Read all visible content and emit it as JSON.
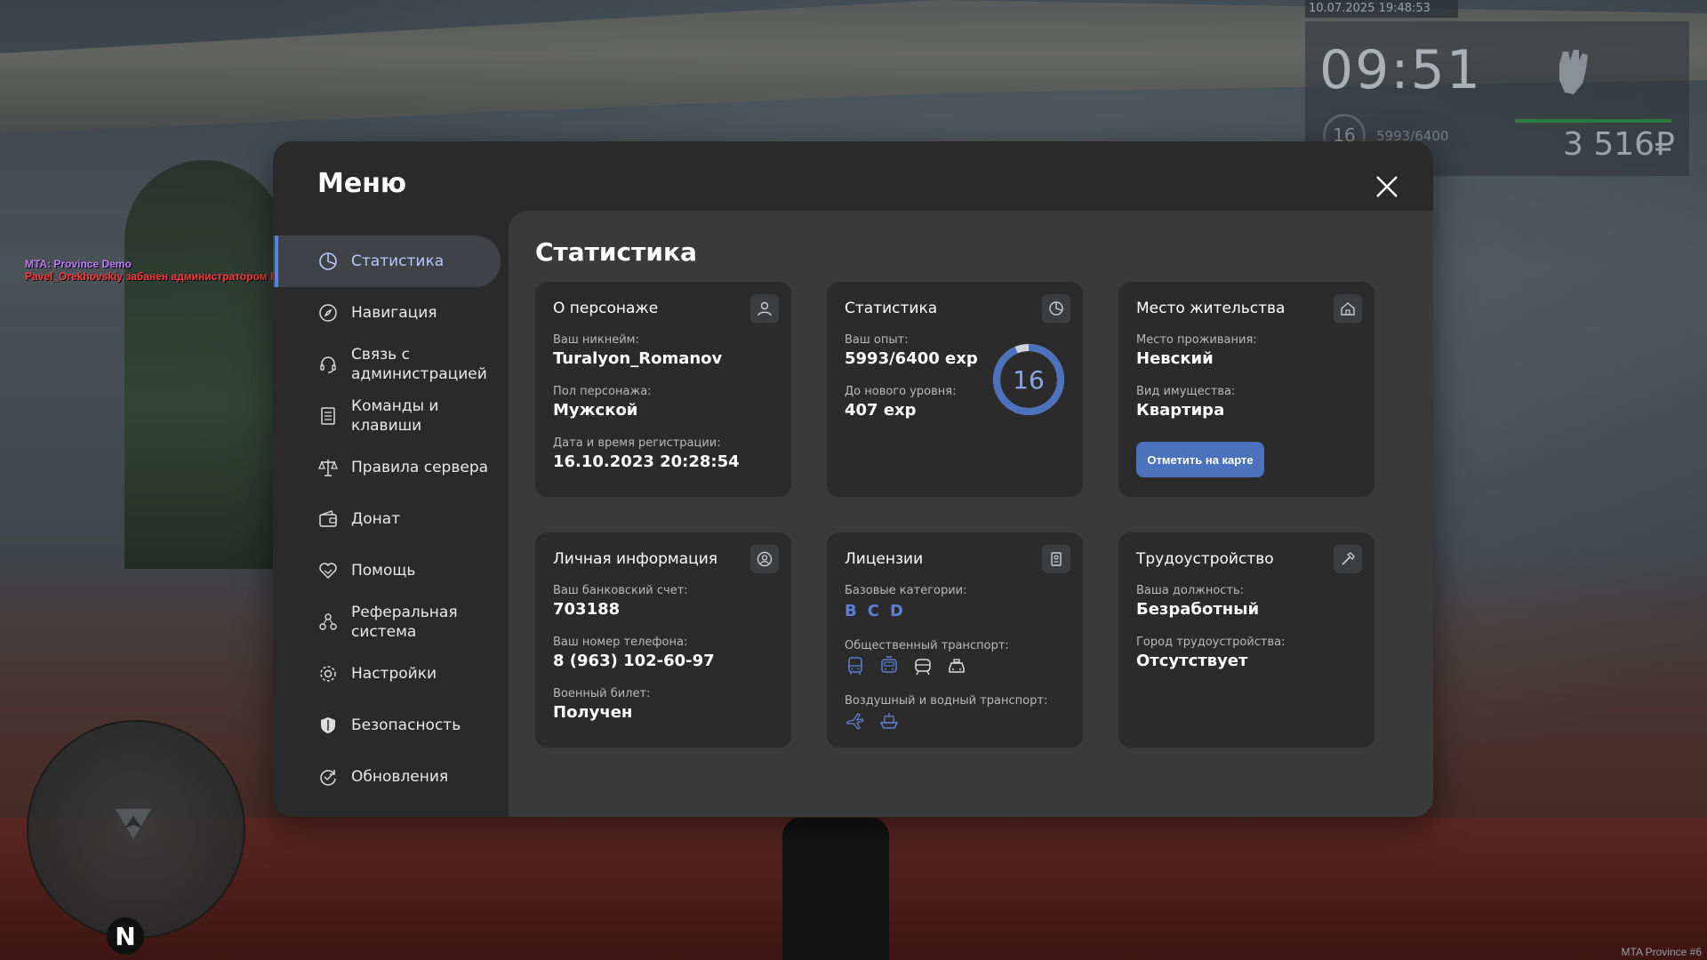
{
  "hud": {
    "datetime": "10.07.2025 19:48:53",
    "time": "09:51",
    "level": "16",
    "exp": "5993/6400",
    "money": "3 516₽"
  },
  "chat": {
    "line1": "MTA: Province Demo",
    "line2": "Pavel_Orekhovskiy забанен администратором Pavel_Good. (Чита by PGD)"
  },
  "minimap": {
    "north": "N"
  },
  "watermark": "MTA Province #6",
  "menu": {
    "title": "Меню",
    "content_title": "Статистика",
    "nav": [
      {
        "label": "Статистика",
        "icon": "pie-chart-icon",
        "active": true
      },
      {
        "label": "Навигация",
        "icon": "compass-icon"
      },
      {
        "label": "Связь с\nадминистрацией",
        "icon": "headset-icon"
      },
      {
        "label": "Команды и\nклавиши",
        "icon": "document-icon"
      },
      {
        "label": "Правила сервера",
        "icon": "scales-icon"
      },
      {
        "label": "Донат",
        "icon": "wallet-icon"
      },
      {
        "label": "Помощь",
        "icon": "handshake-icon"
      },
      {
        "label": "Реферальная\nсистема",
        "icon": "people-icon"
      },
      {
        "label": "Настройки",
        "icon": "gear-icon"
      },
      {
        "label": "Безопасность",
        "icon": "shield-icon"
      },
      {
        "label": "Обновления",
        "icon": "refresh-icon"
      }
    ]
  },
  "cards": {
    "character": {
      "title": "О персонаже",
      "nickname_label": "Ваш никнейм:",
      "nickname": "Turalyon_Romanov",
      "gender_label": "Пол персонажа:",
      "gender": "Мужской",
      "reg_label": "Дата и время регистрации:",
      "reg": "16.10.2023 20:28:54"
    },
    "stats": {
      "title": "Статистика",
      "exp_label": "Ваш опыт:",
      "exp": "5993/6400 exp",
      "next_label": "До нового уровня:",
      "next": "407 exp",
      "level": "16",
      "progress": 0.936,
      "accent": "#4c72be"
    },
    "residence": {
      "title": "Место жительства",
      "place_label": "Место проживания:",
      "place": "Невский",
      "property_label": "Вид имущества:",
      "property": "Квартира",
      "button": "Отметить на карте"
    },
    "personal": {
      "title": "Личная информация",
      "bank_label": "Ваш банковский счет:",
      "bank": "703188",
      "phone_label": "Ваш номер телефона:",
      "phone": "8 (963) 102-60-97",
      "military_label": "Военный билет:",
      "military": "Получен"
    },
    "licenses": {
      "title": "Лицензии",
      "base_label": "Базовые категории:",
      "categories": [
        "B",
        "C",
        "D"
      ],
      "public_label": "Общественный транспорт:",
      "public_icons": [
        "bus-icon",
        "trolleybus-icon",
        "tram-icon",
        "taxi-icon"
      ],
      "air_label": "Воздушный и водный транспорт:",
      "air_icons": [
        "plane-icon",
        "boat-icon"
      ]
    },
    "job": {
      "title": "Трудоустройство",
      "position_label": "Ваша должность:",
      "position": "Безработный",
      "city_label": "Город трудоустройства:",
      "city": "Отсутствует"
    }
  }
}
